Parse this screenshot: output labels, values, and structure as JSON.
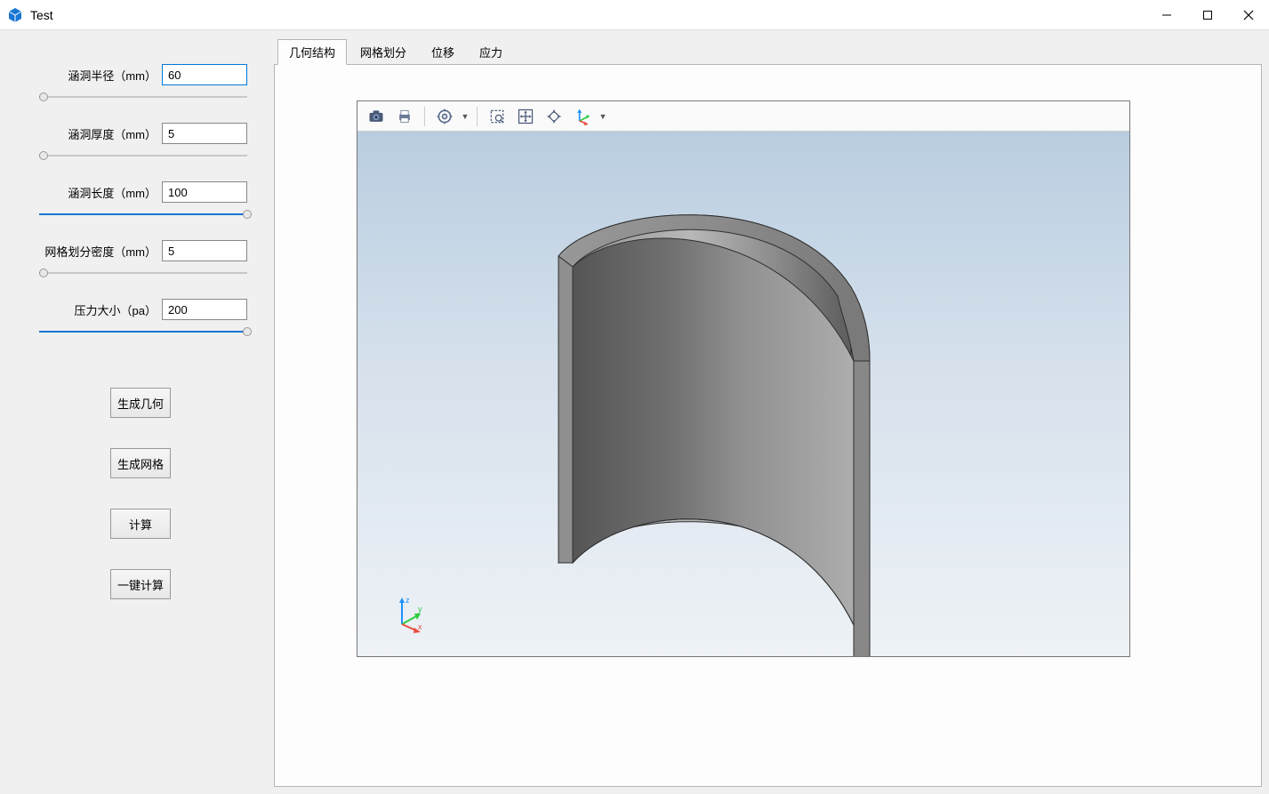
{
  "window": {
    "title": "Test"
  },
  "sidebar": {
    "params": [
      {
        "label": "涵洞半径（mm）",
        "value": "60",
        "fill_pct": 2
      },
      {
        "label": "涵洞厚度（mm）",
        "value": "5",
        "fill_pct": 2
      },
      {
        "label": "涵洞长度（mm）",
        "value": "100",
        "fill_pct": 100
      },
      {
        "label": "网格划分密度（mm）",
        "value": "5",
        "fill_pct": 2
      },
      {
        "label": "压力大小（pa）",
        "value": "200",
        "fill_pct": 100
      }
    ],
    "buttons": {
      "gen_geom": "生成几何",
      "gen_mesh": "生成网格",
      "compute": "计算",
      "one_click": "一键计算"
    }
  },
  "tabs": [
    {
      "label": "几何结构",
      "active": true
    },
    {
      "label": "网格划分",
      "active": false
    },
    {
      "label": "位移",
      "active": false
    },
    {
      "label": "应力",
      "active": false
    }
  ],
  "toolbar_icons": {
    "camera": "camera-icon",
    "print": "print-icon",
    "settings": "settings-icon",
    "select_box": "select-box-icon",
    "pan": "pan-icon",
    "fit": "fit-icon",
    "axes": "axes-icon"
  },
  "axes": {
    "z": "z",
    "y": "y",
    "x": "x"
  }
}
